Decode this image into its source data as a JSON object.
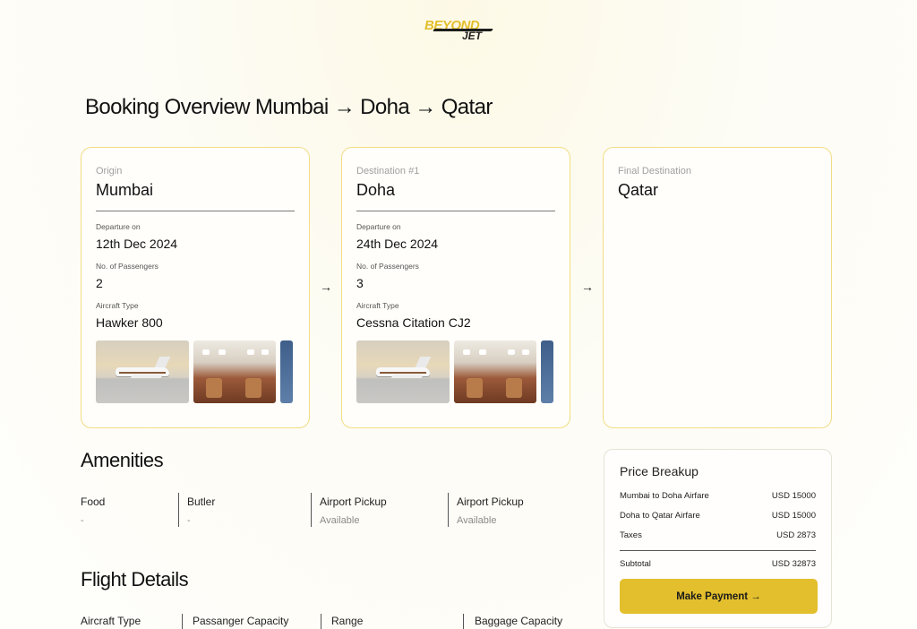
{
  "brand": {
    "line1": "BEYOND",
    "line2": "JET",
    "accent": "#e3bf2d"
  },
  "page_title": "Booking Overview Mumbai → Doha → Qatar",
  "legs": [
    {
      "label": "Origin",
      "city": "Mumbai",
      "departure_label": "Departure on",
      "departure": "12th Dec 2024",
      "passengers_label": "No. of Passengers",
      "passengers": "2",
      "aircraft_label": "Aircraft Type",
      "aircraft": "Hawker 800"
    },
    {
      "label": "Destination #1",
      "city": "Doha",
      "departure_label": "Departure on",
      "departure": "24th Dec 2024",
      "passengers_label": "No. of Passengers",
      "passengers": "3",
      "aircraft_label": "Aircraft Type",
      "aircraft": "Cessna Citation CJ2"
    },
    {
      "label": "Final Destination",
      "city": "Qatar"
    }
  ],
  "arrow_glyph": "→",
  "amenities": {
    "title": "Amenities",
    "items": [
      {
        "name": "Food",
        "value": "-"
      },
      {
        "name": "Butler",
        "value": "-"
      },
      {
        "name": "Airport Pickup",
        "value": "Available"
      },
      {
        "name": "Airport Pickup",
        "value": "Available"
      }
    ]
  },
  "flight_details": {
    "title": "Flight Details",
    "columns": [
      "Aircraft Type",
      "Passanger Capacity",
      "Range",
      "Baggage Capacity"
    ]
  },
  "price": {
    "title": "Price Breakup",
    "rows": [
      {
        "label": "Mumbai to Doha Airfare",
        "amount": "USD 15000"
      },
      {
        "label": "Doha to Qatar Airfare",
        "amount": "USD 15000"
      },
      {
        "label": "Taxes",
        "amount": "USD 2873"
      }
    ],
    "subtotal_label": "Subtotal",
    "subtotal": "USD 32873",
    "pay_label": "Make Payment →"
  }
}
